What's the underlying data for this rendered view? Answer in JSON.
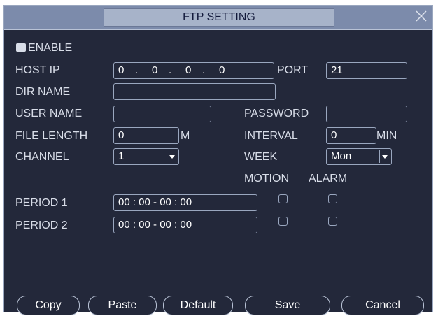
{
  "window": {
    "title": "FTP SETTING"
  },
  "enable": {
    "label": "ENABLE"
  },
  "labels": {
    "host_ip": "HOST IP",
    "port": "PORT",
    "dir_name": "DIR NAME",
    "user_name": "USER NAME",
    "password": "PASSWORD",
    "file_length": "FILE LENGTH",
    "file_length_unit": "M",
    "interval": "INTERVAL",
    "interval_unit": "MIN",
    "channel": "CHANNEL",
    "week": "WEEK",
    "motion": "MOTION",
    "alarm": "ALARM",
    "period1": "PERIOD 1",
    "period2": "PERIOD 2"
  },
  "values": {
    "host_ip_parts": [
      "0",
      ".",
      "0",
      ".",
      "0",
      ".",
      "0"
    ],
    "port": "21",
    "dir_name": "",
    "user_name": "",
    "password": "",
    "file_length": "0",
    "interval": "0",
    "channel": "1",
    "week": "Mon",
    "period1": "00 : 00     - 00 : 00",
    "period2": "00 : 00     - 00 : 00"
  },
  "buttons": {
    "copy": "Copy",
    "paste": "Paste",
    "default": "Default",
    "save": "Save",
    "cancel": "Cancel"
  },
  "colors": {
    "background": "#23283a",
    "titlebar": "#7c8bab",
    "border": "#9aa7bf"
  },
  "icons": {
    "close": "close-icon",
    "dropdown": "chevron-down-icon"
  }
}
